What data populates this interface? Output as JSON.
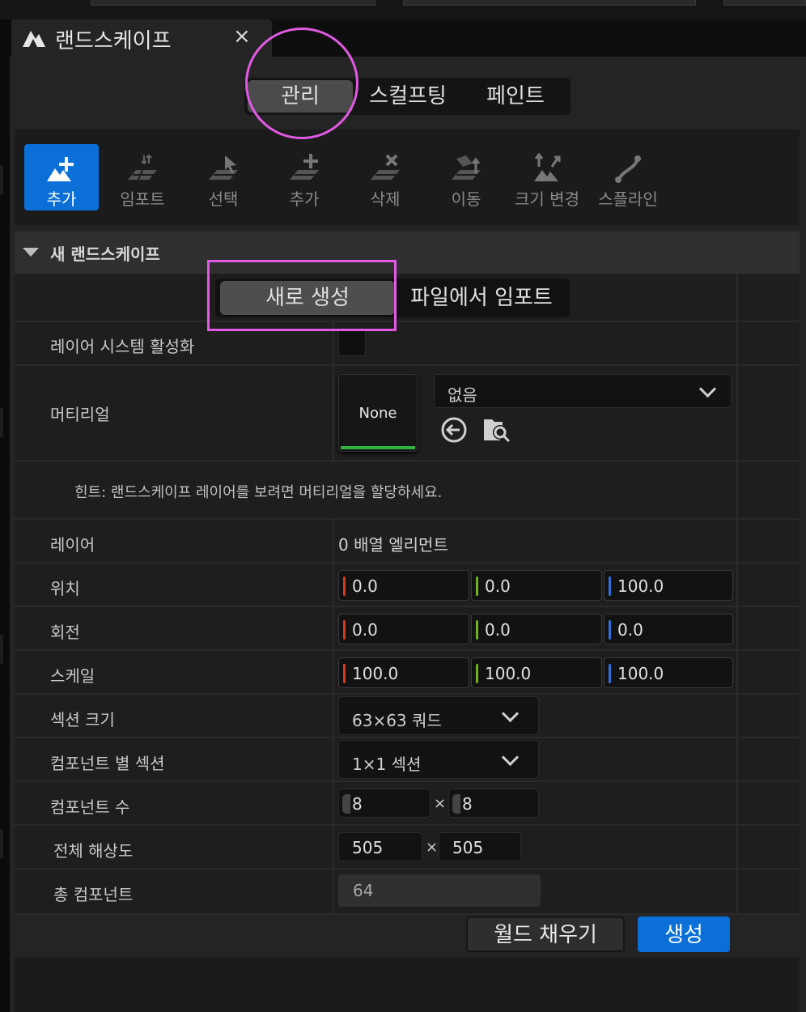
{
  "panel": {
    "title": "랜드스케이프",
    "close_label": "×"
  },
  "modes": [
    "관리",
    "스컬프팅",
    "페인트"
  ],
  "tools": [
    {
      "label": "추가",
      "icon": "landscape-add-icon",
      "active": true
    },
    {
      "label": "임포트",
      "icon": "import-icon"
    },
    {
      "label": "선택",
      "icon": "select-icon"
    },
    {
      "label": "추가",
      "icon": "add-component-icon"
    },
    {
      "label": "삭제",
      "icon": "delete-icon"
    },
    {
      "label": "이동",
      "icon": "move-icon"
    },
    {
      "label": "크기 변경",
      "icon": "resize-icon"
    },
    {
      "label": "스플라인",
      "icon": "spline-icon"
    }
  ],
  "section": {
    "title": "새 랜드스케이프",
    "create_new_label": "새로 생성",
    "import_label": "파일에서 임포트"
  },
  "props": {
    "layer_system_label": "레이어 시스템 활성화",
    "material_label": "머티리얼",
    "material_thumb": "None",
    "material_combo": "없음",
    "hint": "힌트: 랜드스케이프 레이어를 보려면 머티리얼을 할당하세요.",
    "layers_label": "레이어",
    "layers_value": "0 배열 엘리먼트",
    "location_label": "위치",
    "location": {
      "x": "0.0",
      "y": "0.0",
      "z": "100.0"
    },
    "rotation_label": "회전",
    "rotation": {
      "x": "0.0",
      "y": "0.0",
      "z": "0.0"
    },
    "scale_label": "스케일",
    "scale": {
      "x": "100.0",
      "y": "100.0",
      "z": "100.0"
    },
    "section_size_label": "섹션 크기",
    "section_size": "63×63 쿼드",
    "sections_per_comp_label": "컴포넌트 별 섹션",
    "sections_per_comp": "1×1 섹션",
    "comp_count_label": "컴포넌트 수",
    "comp_count": {
      "x": "8",
      "y": "8"
    },
    "resolution_label": "전체 해상도",
    "resolution": {
      "x": "505",
      "y": "505"
    },
    "total_comp_label": "총 컴포넌트",
    "total_comp": "64",
    "times": "×"
  },
  "buttons": {
    "fill_world": "월드 채우기",
    "create": "생성"
  },
  "colors": {
    "accent": "#0a70d8",
    "x_axis": "#d63a1e",
    "y_axis": "#6fb120",
    "z_axis": "#2d73e0",
    "highlight": "#e15ae3"
  }
}
